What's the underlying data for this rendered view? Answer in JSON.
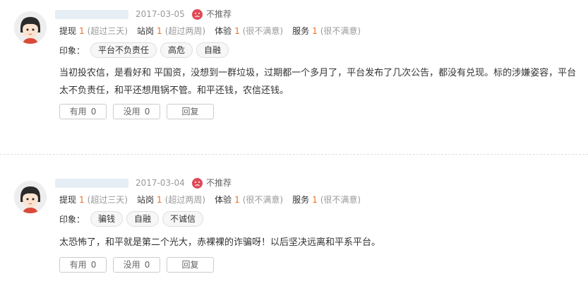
{
  "reviews": [
    {
      "date": "2017-03-05",
      "recommend": "不推荐",
      "ratings": [
        {
          "name": "提现",
          "score": "1",
          "desc": "(超过三天)"
        },
        {
          "name": "站岗",
          "score": "1",
          "desc": "(超过两周)"
        },
        {
          "name": "体验",
          "score": "1",
          "desc": "(很不满意)"
        },
        {
          "name": "服务",
          "score": "1",
          "desc": "(很不满意)"
        }
      ],
      "tags_label": "印象：",
      "tags": [
        "平台不负责任",
        "高危",
        "自融"
      ],
      "content": "当初投农信，是看好和 平国资，没想到一群垃圾，过期都一个多月了，平台发布了几次公告，都没有兑现。标的涉嫌姿容，平台太不负责任，和平还想甩锅不管。和平还钱，农信还钱。",
      "useful_label": "有用",
      "useful_count": "0",
      "useless_label": "没用",
      "useless_count": "0",
      "reply_label": "回复"
    },
    {
      "date": "2017-03-04",
      "recommend": "不推荐",
      "ratings": [
        {
          "name": "提现",
          "score": "1",
          "desc": "(超过三天)"
        },
        {
          "name": "站岗",
          "score": "1",
          "desc": "(超过两周)"
        },
        {
          "name": "体验",
          "score": "1",
          "desc": "(很不满意)"
        },
        {
          "name": "服务",
          "score": "1",
          "desc": "(很不满意)"
        }
      ],
      "tags_label": "印象：",
      "tags": [
        "骗钱",
        "自融",
        "不诚信"
      ],
      "content": "太恐怖了，和平就是第二个光大，赤裸裸的诈骗呀！以后坚决远离和平系平台。",
      "useful_label": "有用",
      "useful_count": "0",
      "useless_label": "没用",
      "useless_count": "0",
      "reply_label": "回复"
    }
  ],
  "colors": {
    "score": "#f26c1f",
    "sad_face": "#e04a57"
  },
  "icons": {
    "avatar": "avatar-cartoon-icon",
    "recommend": "sad-face-icon"
  }
}
